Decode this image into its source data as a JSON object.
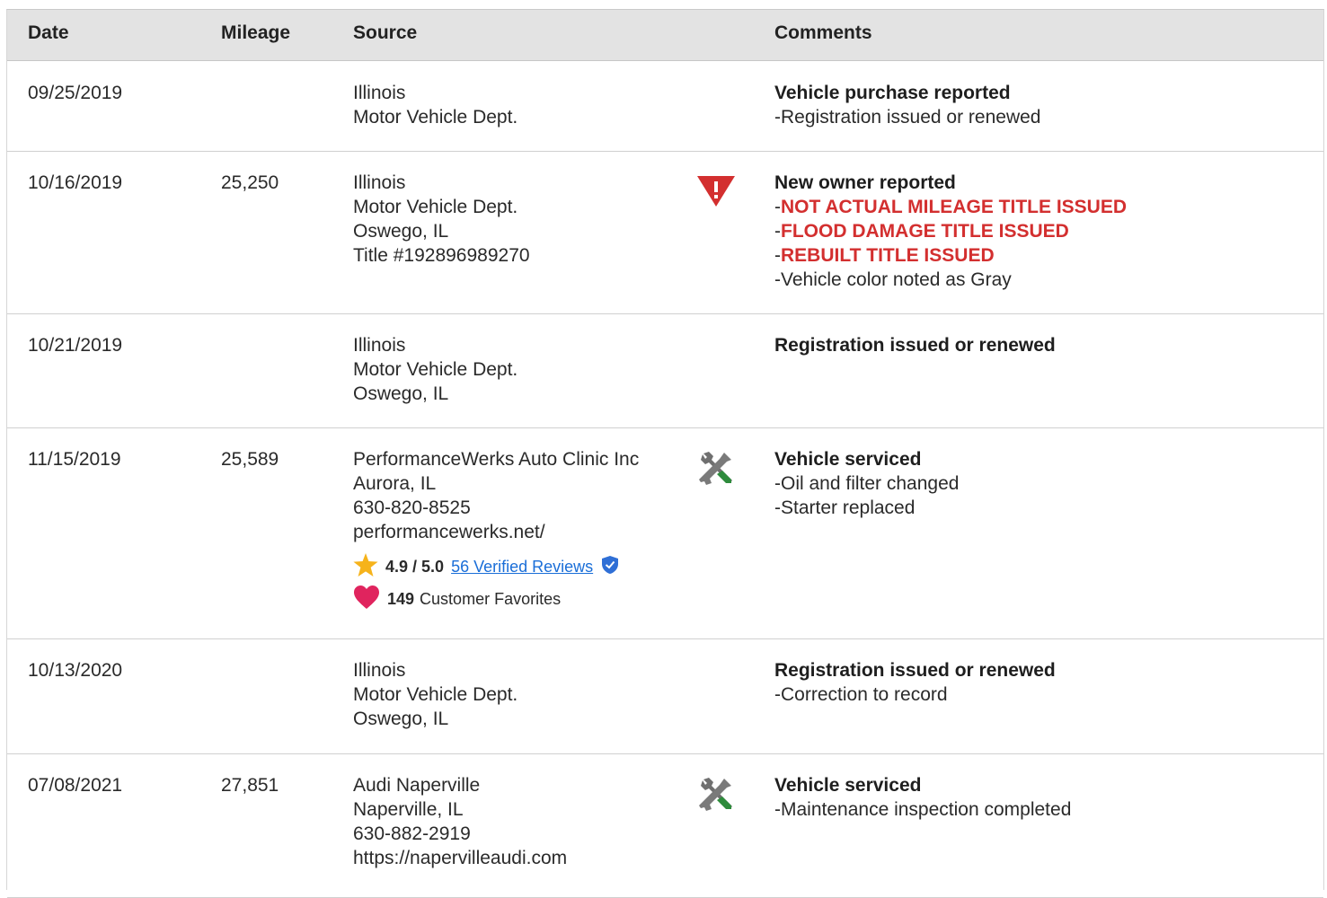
{
  "table": {
    "headers": {
      "date": "Date",
      "mileage": "Mileage",
      "source": "Source",
      "comments": "Comments"
    },
    "rows": [
      {
        "date": "09/25/2019",
        "mileage": "",
        "source": [
          "Illinois",
          "Motor Vehicle Dept."
        ],
        "icon": "",
        "comment_title": "Vehicle purchase reported",
        "comments": [
          {
            "text": "Registration issued or renewed",
            "alert": false
          }
        ]
      },
      {
        "date": "10/16/2019",
        "mileage": "25,250",
        "source": [
          "Illinois",
          "Motor Vehicle Dept.",
          "Oswego, IL",
          "Title #192896989270"
        ],
        "icon": "warning-icon",
        "comment_title": "New owner reported",
        "comments": [
          {
            "text": "NOT ACTUAL MILEAGE TITLE ISSUED",
            "alert": true
          },
          {
            "text": "FLOOD DAMAGE TITLE ISSUED",
            "alert": true
          },
          {
            "text": "REBUILT TITLE ISSUED",
            "alert": true
          },
          {
            "text": "Vehicle color noted as Gray",
            "alert": false
          }
        ]
      },
      {
        "date": "10/21/2019",
        "mileage": "",
        "source": [
          "Illinois",
          "Motor Vehicle Dept.",
          "Oswego, IL"
        ],
        "icon": "",
        "comment_title": "Registration issued or renewed",
        "comments": []
      },
      {
        "date": "11/15/2019",
        "mileage": "25,589",
        "source": [
          "PerformanceWerks Auto Clinic Inc",
          "Aurora, IL",
          "630-820-8525",
          "performancewerks.net/"
        ],
        "icon": "service-tools-icon",
        "rating": "4.9 / 5.0",
        "reviews": "56 Verified Reviews",
        "favorites_count": "149",
        "favorites_label": "Customer Favorites",
        "comment_title": "Vehicle serviced",
        "comments": [
          {
            "text": "Oil and filter changed",
            "alert": false
          },
          {
            "text": "Starter replaced",
            "alert": false
          }
        ]
      },
      {
        "date": "10/13/2020",
        "mileage": "",
        "source": [
          "Illinois",
          "Motor Vehicle Dept.",
          "Oswego, IL"
        ],
        "icon": "",
        "comment_title": "Registration issued or renewed",
        "comments": [
          {
            "text": "Correction to record",
            "alert": false
          }
        ]
      },
      {
        "date": "07/08/2021",
        "mileage": "27,851",
        "source": [
          "Audi Naperville",
          "Naperville, IL",
          "630-882-2919",
          "https://napervilleaudi.com"
        ],
        "icon": "service-tools-icon",
        "comment_title": "Vehicle serviced",
        "comments": [
          {
            "text": "Maintenance inspection completed",
            "alert": false
          }
        ]
      }
    ]
  },
  "colors": {
    "alert": "#d32f2f",
    "link": "#1a6ed8",
    "header_bg": "#e3e3e3",
    "star": "#f6b31b",
    "heart": "#e0245e",
    "verified": "#2f6fd6",
    "wrench_green": "#2e8b3c"
  }
}
